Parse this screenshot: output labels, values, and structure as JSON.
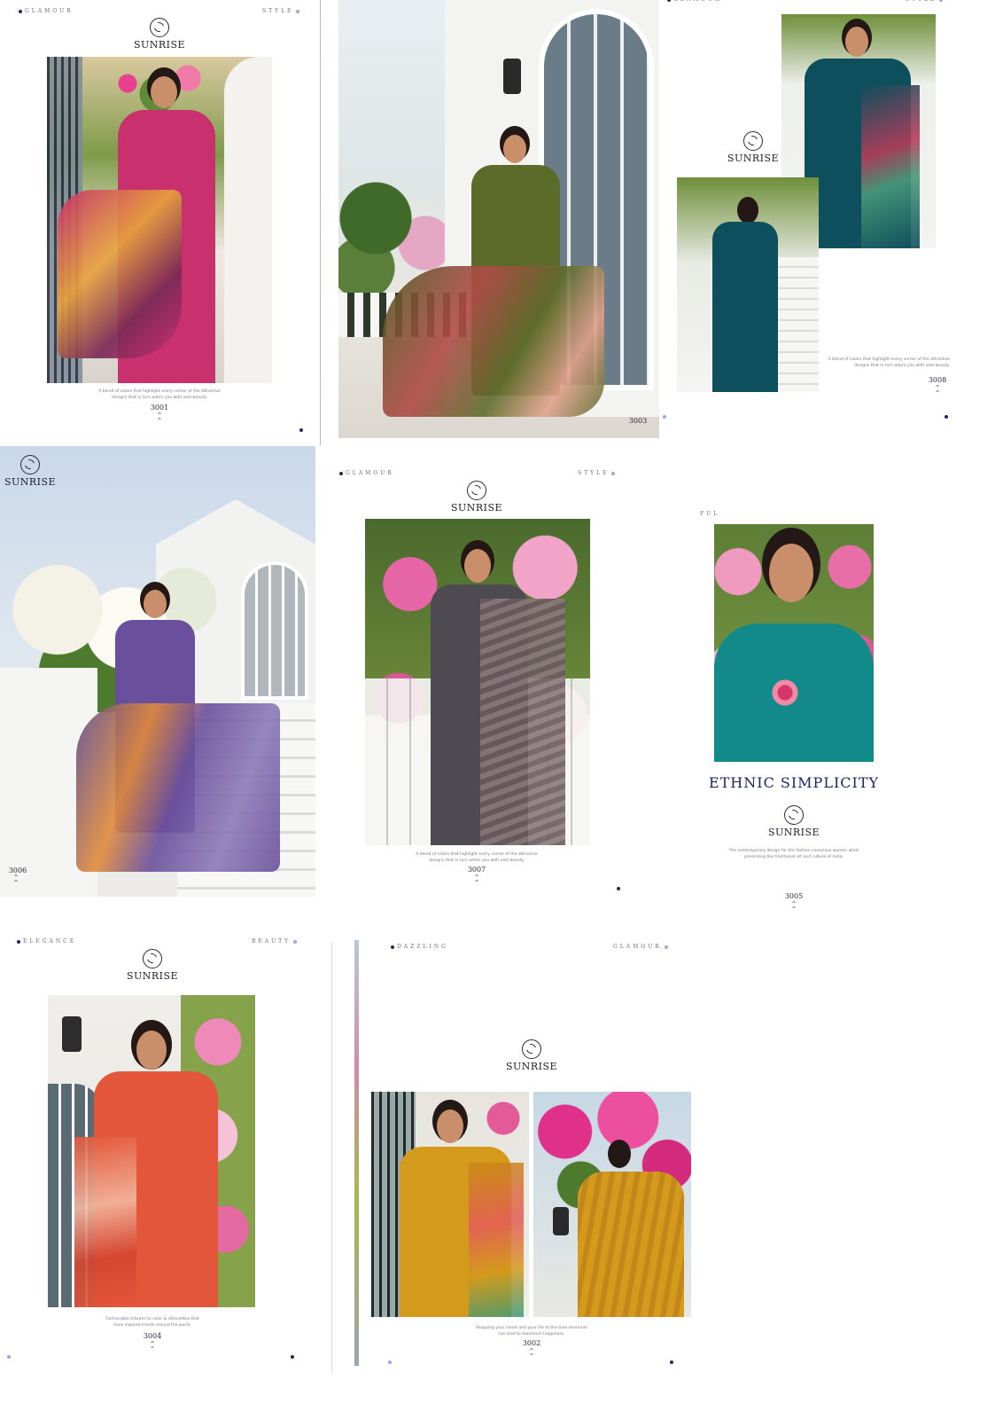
{
  "colors": {
    "navy_dot": "#1f2a5a",
    "lavender_dot": "#9aa6e6",
    "title_navy": "#1c2566",
    "dress_3001": "#c8306e",
    "dress_3003": "#5d6b2a",
    "dress_3008": "#0d4f5c",
    "dress_3006": "#6a4f9c",
    "dress_3007": "#4d4a52",
    "dress_3005": "#138a8a",
    "dress_3004": "#e4563a",
    "dress_3002": "#d49a1c"
  },
  "icons": {
    "logo": "sunrise-logo-icon",
    "chevron": "double-chevron-up-icon"
  },
  "brand": "SUNRISE",
  "tags": {
    "glamour": "GLAMOUR",
    "style": "STYLE",
    "elegance": "ELEGANCE",
    "beauty": "BEAUTY",
    "dazzling": "DAZZLING",
    "ful": "FUL"
  },
  "captions": {
    "blend_line1": "A blend of colors that highlight every corner of the attractive",
    "blend_line2": "designs that in turn adorn you with vast beauty.",
    "ethnic_line1": "The contemporary design for the fashion conscious women while",
    "ethnic_line2": "preserving the traditional art and culture of India.",
    "fashion_line1": "Fashionable tributes to color & silhouettes that",
    "fashion_line2": "have inspired trends around the world.",
    "shopping_line1": "Shopping your closet and your life to the bare minimum",
    "shopping_line2": "can lead to maximum happiness."
  },
  "ethnic_title": "ETHNIC SIMPLICITY",
  "codes": {
    "c3001": "3001",
    "c3003": "3003",
    "c3008": "3008",
    "c3006": "3006",
    "c3007": "3007",
    "c3005": "3005",
    "c3004": "3004",
    "c3002": "3002"
  }
}
